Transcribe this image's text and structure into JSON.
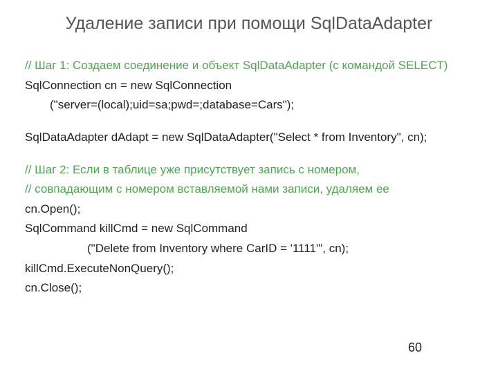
{
  "title": "Удаление записи при помощи SqlDataAdapter",
  "lines": {
    "c1": "// Шаг 1: Создаем соединение и объект SqlDataAdapter  (с командой SELECT)",
    "l1": "SqlConnection cn = new SqlConnection",
    "l2": "(\"server=(local);uid=sa;pwd=;database=Cars\");",
    "l3": "SqlDataAdapter dAdapt = new SqlDataAdapter(\"Select * from Inventory\", cn);",
    "c2": "// Шаг 2: Если в таблице уже присутствует запись с номером,",
    "c3": "// совпадающим  с номером вставляемой нами записи, удаляем ее",
    "l4": "cn.Open();",
    "l5": "SqlCommand killCmd = new SqlCommand",
    "l6": "(\"Delete from Inventory where CarID = '1111'\", cn);",
    "l7": "killCmd.ExecuteNonQuery();",
    "l8": "cn.Close();"
  },
  "page_number": "60"
}
